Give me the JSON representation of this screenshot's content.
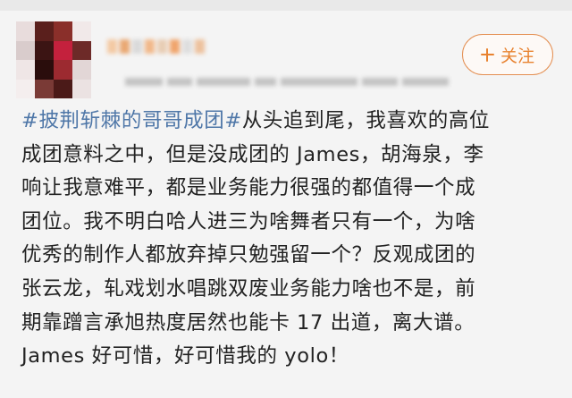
{
  "colors": {
    "background": "#f4f4f4",
    "text": "#222222",
    "hashtag": "#4f77a8",
    "follow_accent": "#e8822f"
  },
  "header": {
    "avatar_icon": "pixelated-avatar-icon",
    "follow_button": {
      "icon": "plus-icon",
      "label": "关注"
    }
  },
  "post": {
    "hashtag": "#披荆斩棘的哥哥成团#",
    "first_line_rest": "从头追到尾，我喜欢的高位",
    "lines": [
      "成团意料之中，但是没成团的 James，胡海泉，李",
      "响让我意难平，都是业务能力很强的都值得一个成",
      "团位。我不明白哈人进三为啥舞者只有一个，为啥",
      "优秀的制作人都放弃掉只勉强留一个？反观成团的",
      "张云龙，轧戏划水唱跳双废业务能力啥也不是，前",
      "期靠蹭言承旭热度居然也能卡 17 出道，离大谱。",
      "James 好可惜，好可惜我的 yolo！"
    ]
  }
}
